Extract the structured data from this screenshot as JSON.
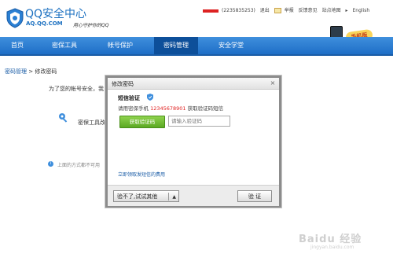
{
  "header": {
    "title": "QQ安全中心",
    "domain": "AQ.QQ.COM",
    "slogan": "用心守护你的QQ",
    "account": "(2235835253)",
    "logout": "退出",
    "report": "举报",
    "feedback": "反馈意见",
    "sitemap": "站点地图",
    "language": "English",
    "promo": "手机版"
  },
  "nav": {
    "items": [
      {
        "label": "首页"
      },
      {
        "label": "密保工具"
      },
      {
        "label": "帐号保护"
      },
      {
        "label": "密码管理"
      },
      {
        "label": "安全学堂"
      }
    ],
    "active_index": 3
  },
  "breadcrumb": {
    "parent": "密码管理",
    "separator": ">",
    "current": "修改密码"
  },
  "page": {
    "notice": "为了您的帐号安全，我",
    "tool_text": "密保工具改",
    "bottom_text": "上面的方式都不可用"
  },
  "dialog": {
    "title": "修改密码",
    "close_symbol": "×",
    "section_title": "短信验证",
    "prefix": "请用密保手机",
    "phone": "12345678901",
    "suffix": "获取验证码短信",
    "get_code_label": "获取验证码",
    "code_placeholder": "请输入验证码",
    "help_link": "立即领取发短信的费用",
    "alt_label": "验不了,试试其他",
    "alt_caret": "▲",
    "verify_label": "验 证"
  },
  "watermark": {
    "text": "Baidu 经验",
    "sub": "jingyan.baidu.com"
  },
  "colors": {
    "brand_blue": "#1e6ec6",
    "nav_active": "#0d4f9a",
    "green_button": "#5aa822",
    "phone_red": "#e02020"
  }
}
